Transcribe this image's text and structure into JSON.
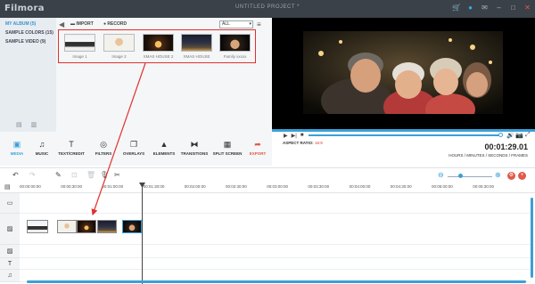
{
  "titlebar": {
    "logo": "Filmora",
    "title": "UNTITLED PROJECT *",
    "icons": [
      "cart-icon",
      "chat-icon",
      "mail-icon",
      "minimize-icon",
      "maximize-icon",
      "close-icon"
    ]
  },
  "album": {
    "items": [
      {
        "label": "MY ALBUM (5)",
        "active": true
      },
      {
        "label": "SAMPLE COLORS (15)",
        "active": false
      },
      {
        "label": "SAMPLE VIDEO (9)",
        "active": false
      }
    ],
    "bottom_icons": [
      "add-folder-icon",
      "delete-folder-icon"
    ]
  },
  "media_toolbar": {
    "back_glyph": "◀",
    "import_label": "IMPORT",
    "record_label": "RECORD",
    "filter_value": "ALL",
    "menu_glyph": "≡"
  },
  "media_items": [
    {
      "caption": "Image 1"
    },
    {
      "caption": "Image 2"
    },
    {
      "caption": "XMAS HOUSE 2"
    },
    {
      "caption": "XMAS HOUSE"
    },
    {
      "caption": "Family xxxxx"
    }
  ],
  "preview": {
    "aspect_label": "ASPECT RATIO:",
    "aspect_value": "16:9",
    "time": "00:01:29.01",
    "time_format": "HOURS / MINUTES / SECONDS / FRAMES",
    "progress": 1.0
  },
  "modules": [
    {
      "label": "MEDIA",
      "icon": "media-icon",
      "glyph": "▣",
      "active": true
    },
    {
      "label": "MUSIC",
      "icon": "music-icon",
      "glyph": "♫"
    },
    {
      "label": "TEXT/CREDIT",
      "icon": "text-icon",
      "glyph": "T"
    },
    {
      "label": "FILTERS",
      "icon": "filters-icon",
      "glyph": "◎"
    },
    {
      "label": "OVERLAYS",
      "icon": "overlays-icon",
      "glyph": "❐"
    },
    {
      "label": "ELEMENTS",
      "icon": "elements-icon",
      "glyph": "▲"
    },
    {
      "label": "TRANSITIONS",
      "icon": "transitions-icon",
      "glyph": "⧓"
    },
    {
      "label": "SPLIT SCREEN",
      "icon": "split-screen-icon",
      "glyph": "▦"
    },
    {
      "label": "EXPORT",
      "icon": "export-icon",
      "glyph": "➦",
      "export": true
    }
  ],
  "ruler_ticks": [
    "00:00:00:00",
    "00:00:30:00",
    "00:01:00:00",
    "00:01:30:00",
    "00:02:00:00",
    "00:02:30:00",
    "00:03:00:00",
    "00:03:30:00",
    "00:04:00:00",
    "00:04:30:00",
    "00:05:00:00",
    "00:05:30:00"
  ],
  "tracks": [
    {
      "icon": "video-track-icon",
      "glyph": "▭"
    },
    {
      "icon": "image-track-icon",
      "glyph": "▨"
    },
    {
      "icon": "pip-track-icon",
      "glyph": "▨"
    },
    {
      "icon": "text-track-icon",
      "glyph": "T"
    },
    {
      "icon": "music-track-icon",
      "glyph": "♫"
    }
  ],
  "colors": {
    "accent": "#3aa0d8",
    "annotation": "#e0312f"
  }
}
